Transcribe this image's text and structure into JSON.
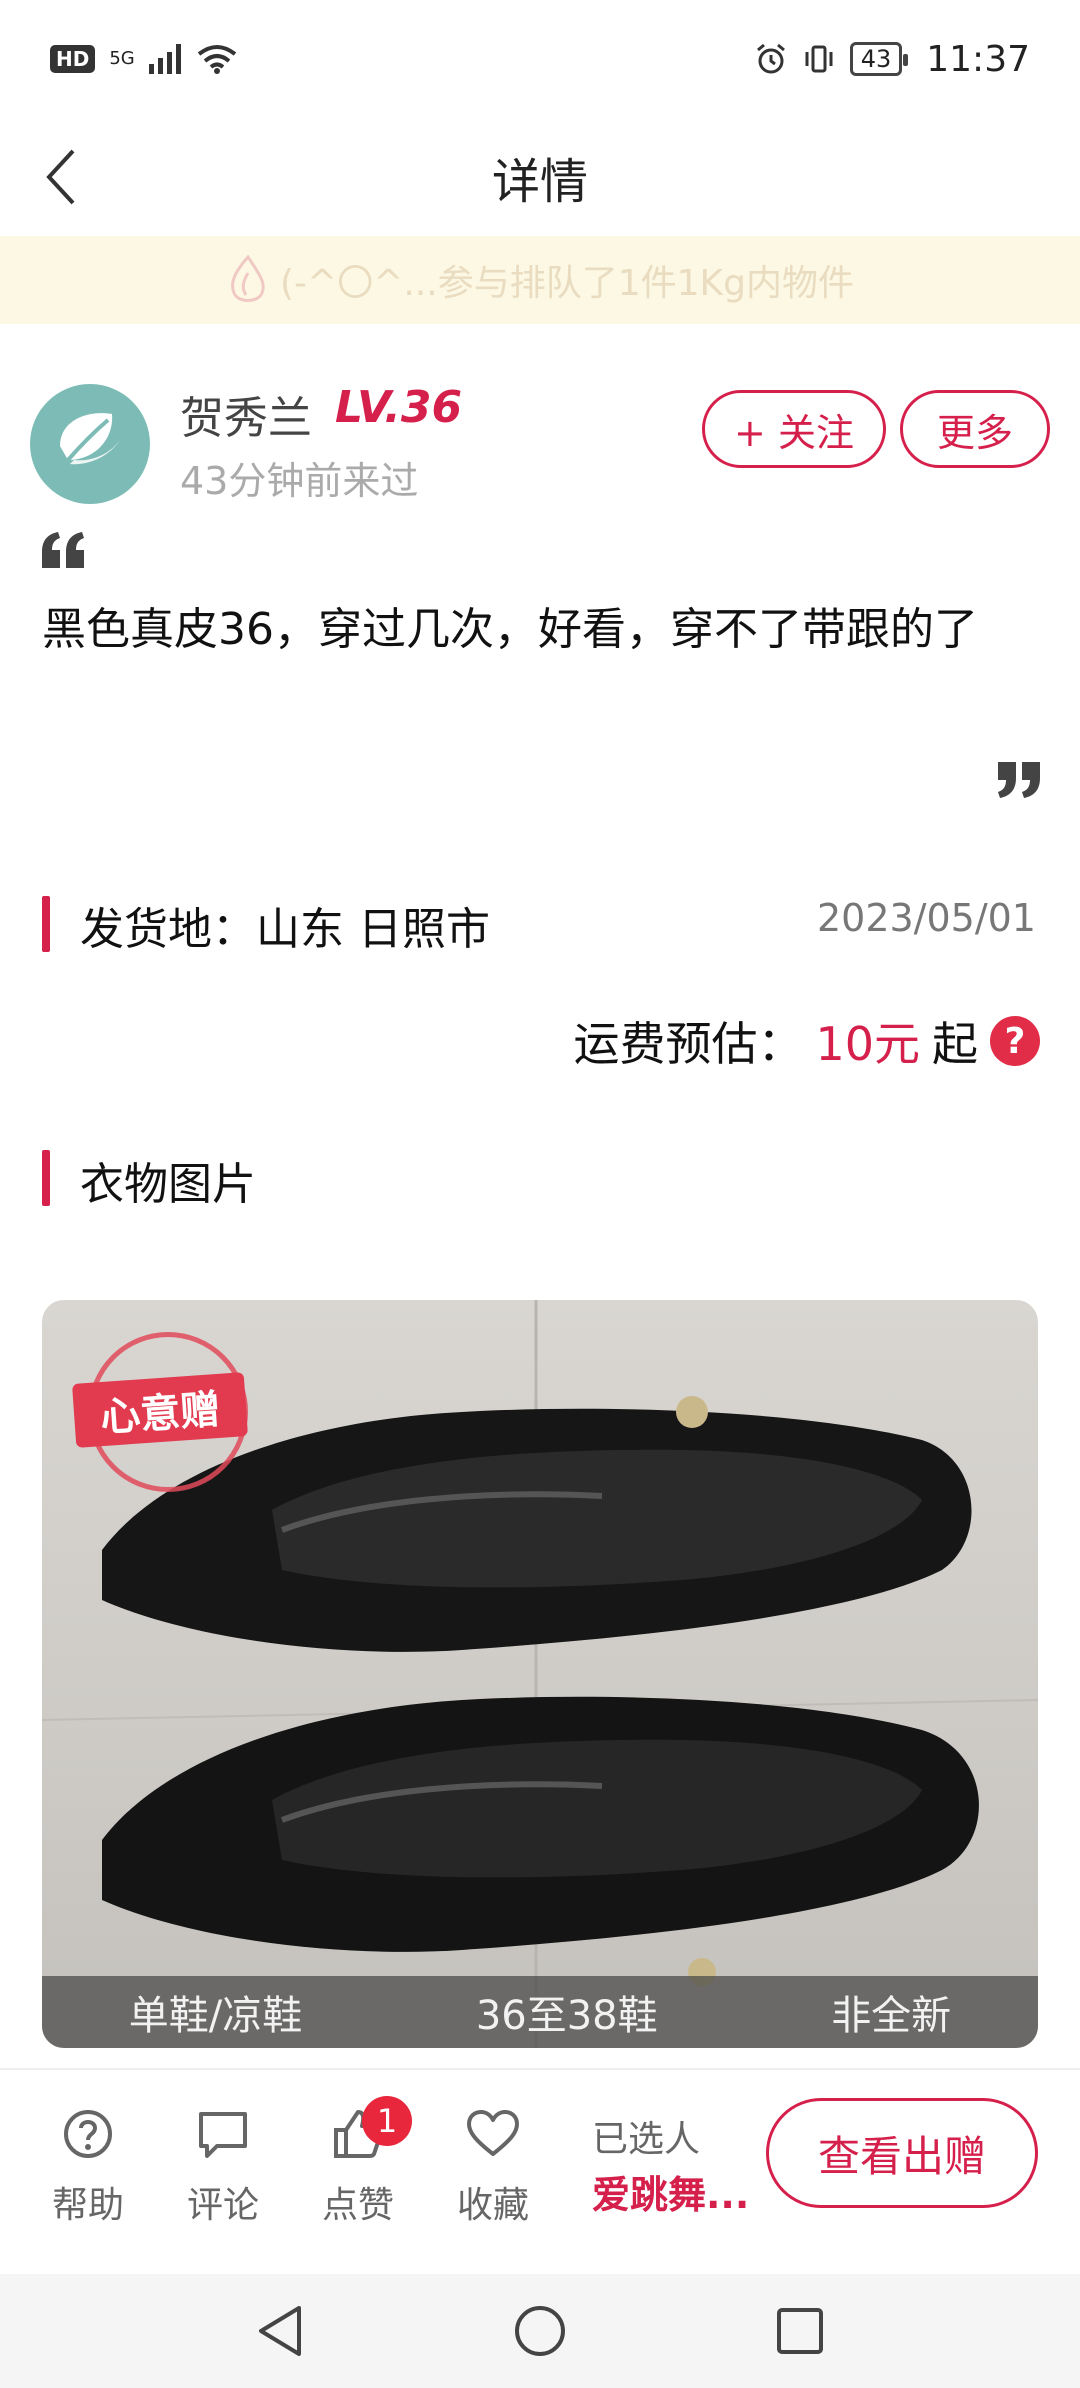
{
  "status_bar": {
    "hd": "HD",
    "network": "5G",
    "battery": "43",
    "time": "11:37"
  },
  "header": {
    "title": "详情"
  },
  "notice": {
    "text": "(-^〇^...参与排队了1件1Kg内物件"
  },
  "user": {
    "name": "贺秀兰",
    "level": "LV.36",
    "last_seen": "43分钟前来过",
    "follow_label": "+ 关注",
    "more_label": "更多"
  },
  "post": {
    "description": "黑色真皮36，穿过几次，好看，穿不了带跟的了"
  },
  "shipping": {
    "origin_label": "发货地：山东 日照市",
    "date": "2023/05/01",
    "fee_label": "运费预估：",
    "fee_value": "10元",
    "fee_suffix": "起",
    "help_glyph": "?"
  },
  "photos": {
    "section_title": "衣物图片",
    "stamp_label": "心意赠",
    "tags": [
      "单鞋/凉鞋",
      "36至38鞋",
      "非全新"
    ]
  },
  "bottom_bar": {
    "actions": [
      {
        "label": "帮助",
        "icon": "help-circle-icon"
      },
      {
        "label": "评论",
        "icon": "comment-icon"
      },
      {
        "label": "点赞",
        "icon": "thumbs-up-icon",
        "badge": "1"
      },
      {
        "label": "收藏",
        "icon": "heart-icon"
      }
    ],
    "selected_prefix": "已选人",
    "selected_name": "爱跳舞...",
    "view_gift_label": "查看出赠"
  },
  "colors": {
    "accent": "#d6204c",
    "notice_bg": "#fcf8e3",
    "avatar_bg": "#7dbcb6"
  }
}
